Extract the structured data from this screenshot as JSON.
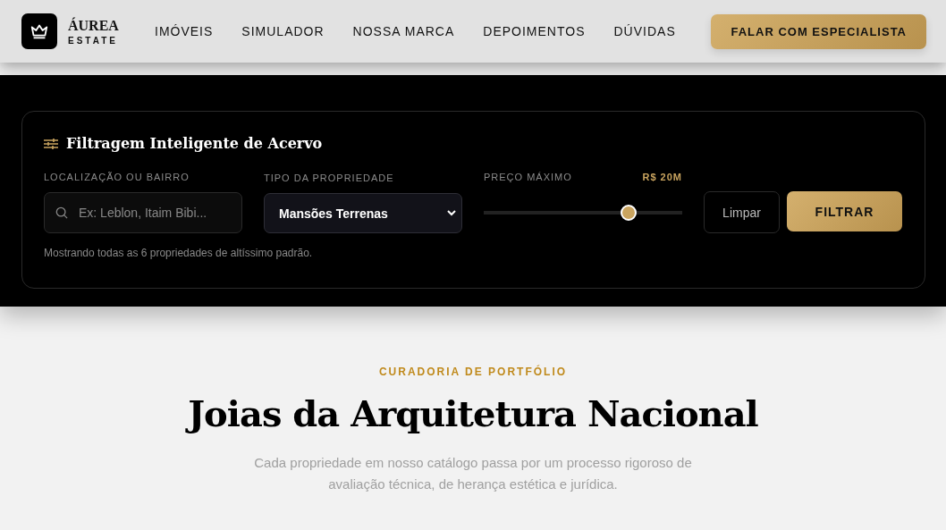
{
  "brand": {
    "name": "ÁUREA",
    "subtitle": "ESTATE"
  },
  "nav": [
    {
      "label": "IMÓVEIS"
    },
    {
      "label": "SIMULADOR"
    },
    {
      "label": "NOSSA MARCA"
    },
    {
      "label": "DEPOIMENTOS"
    },
    {
      "label": "DÚVIDAS"
    }
  ],
  "cta": "FALAR COM ESPECIALISTA",
  "filter": {
    "title": "Filtragem Inteligente de Acervo",
    "location": {
      "label": "LOCALIZAÇÃO OU BAIRRO",
      "placeholder": "Ex: Leblon, Itaim Bibi..."
    },
    "type": {
      "label": "TIPO DA PROPRIEDADE",
      "value": "Mansões Terrenas"
    },
    "price": {
      "label": "PREÇO MÁXIMO",
      "reading": "R$ 20M",
      "level": 0.73
    },
    "clear": "Limpar",
    "submit": "FILTRAR",
    "status": "Mostrando todas as 6 propriedades de altíssimo padrão."
  },
  "section": {
    "eyebrow": "CURADORIA DE PORTFÓLIO",
    "title": "Joias da Arquitetura Nacional",
    "text": "Cada propriedade em nosso catálogo passa por um processo rigoroso de avaliação técnica, de herança estética e jurídica."
  }
}
